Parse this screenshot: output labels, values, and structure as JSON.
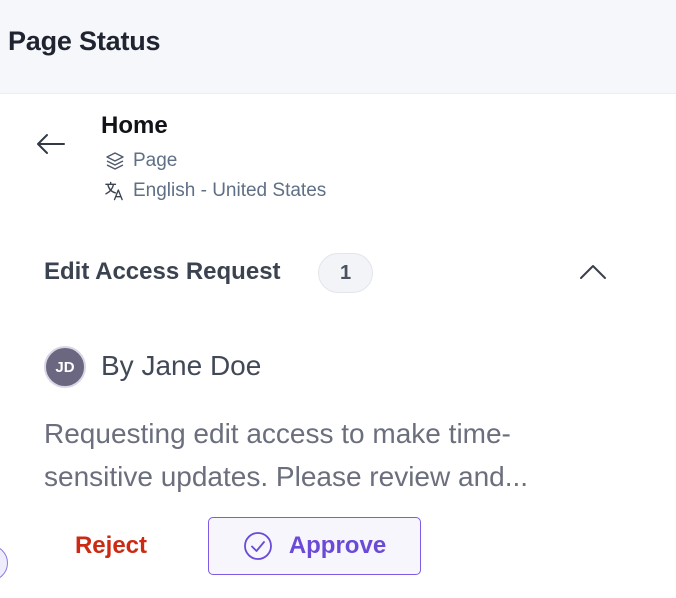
{
  "header": {
    "title": "Page Status"
  },
  "page": {
    "title": "Home",
    "type_label": "Page",
    "locale_label": "English - United States",
    "back_icon": "arrow-left-icon",
    "type_icon": "layers-icon",
    "locale_icon": "translate-icon"
  },
  "request_section": {
    "title": "Edit Access Request",
    "count": "1",
    "collapse_icon": "chevron-up-icon"
  },
  "request": {
    "avatar_initials": "JD",
    "author": "By Jane Doe",
    "message": "Requesting edit access to make time-sensitive updates. Please review and..."
  },
  "actions": {
    "reject_label": "Reject",
    "approve_label": "Approve",
    "approve_icon": "check-circle-icon"
  },
  "colors": {
    "reject": "#cc2a13",
    "approve": "#6a4ad6",
    "avatar_bg": "#6b6780",
    "header_bg": "#f6f7fb"
  }
}
